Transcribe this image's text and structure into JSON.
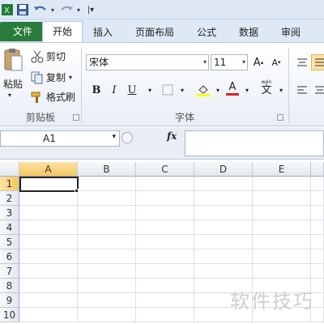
{
  "quick_access": {
    "icons": [
      "excel-logo-icon",
      "save-icon",
      "undo-icon",
      "redo-icon",
      "customize-icon"
    ]
  },
  "tabs": [
    "文件",
    "开始",
    "插入",
    "页面布局",
    "公式",
    "数据",
    "审阅"
  ],
  "ribbon": {
    "clipboard": {
      "paste_label": "粘贴",
      "cut_label": "剪切",
      "copy_label": "复制",
      "format_painter_label": "格式刷",
      "group_label": "剪贴板"
    },
    "font": {
      "font_name": "宋体",
      "font_size": "11",
      "group_label": "字体",
      "bold": "B",
      "italic": "I",
      "underline": "U",
      "font_color_glyph": "A",
      "phonetic_glyph": "文"
    }
  },
  "formula_bar": {
    "name_box": "A1",
    "fx_label": "fx",
    "formula": ""
  },
  "grid": {
    "columns": [
      "A",
      "B",
      "C",
      "D",
      "E"
    ],
    "rows": [
      "1",
      "2",
      "3",
      "4",
      "5",
      "6",
      "7",
      "8",
      "9",
      "10"
    ],
    "active_cell": "A1"
  },
  "watermark": "软件技巧"
}
